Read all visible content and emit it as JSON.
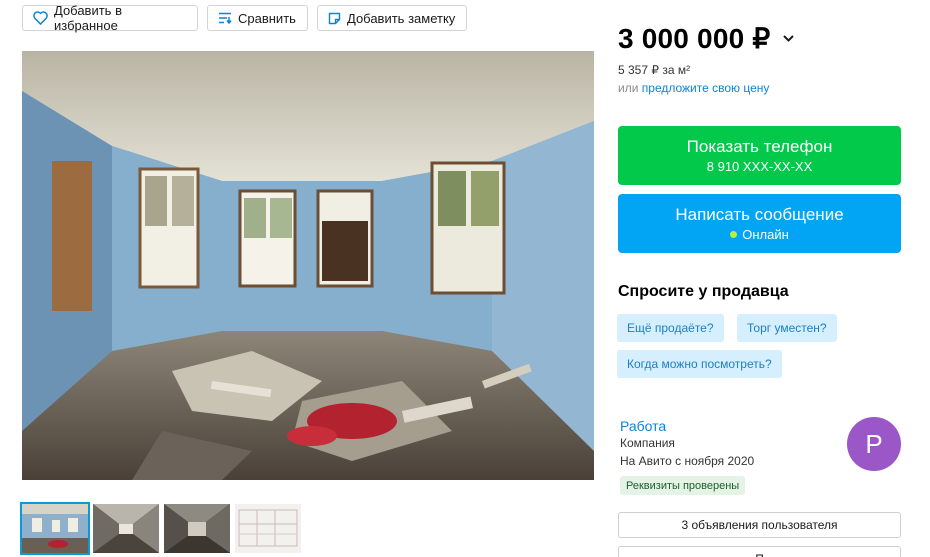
{
  "toolbar": {
    "favorite_label": "Добавить в избранное",
    "compare_label": "Сравнить",
    "note_label": "Добавить заметку"
  },
  "gallery": {
    "thumbnails": [
      "photo-1",
      "photo-2",
      "photo-3",
      "photo-4"
    ]
  },
  "price": {
    "value": "3 000 000 ₽",
    "per_unit": "5 357 ₽ за м²",
    "or_text": "или",
    "offer_link": "предложите свою цену"
  },
  "contact": {
    "phone_label": "Показать телефон",
    "phone_masked": "8 910 XXX-XX-XX",
    "message_label": "Написать сообщение",
    "online_status": "Онлайн"
  },
  "ask_seller": {
    "title": "Спросите у продавца",
    "questions": [
      "Ещё продаёте?",
      "Торг уместен?",
      "Когда можно посмотреть?"
    ]
  },
  "seller": {
    "name": "Работа",
    "type": "Компания",
    "since": "На Авито с ноября 2020",
    "verified_badge": "Реквизиты проверены",
    "avatar_letter": "P"
  },
  "listings": {
    "user_listings_label": "3 объявления пользователя",
    "second_button_label": "П"
  },
  "colors": {
    "phone_button": "#03c94b",
    "message_button": "#02a4f4",
    "link": "#0a85d6",
    "chip_bg": "#d6efff",
    "avatar_bg": "#9b57c7"
  }
}
